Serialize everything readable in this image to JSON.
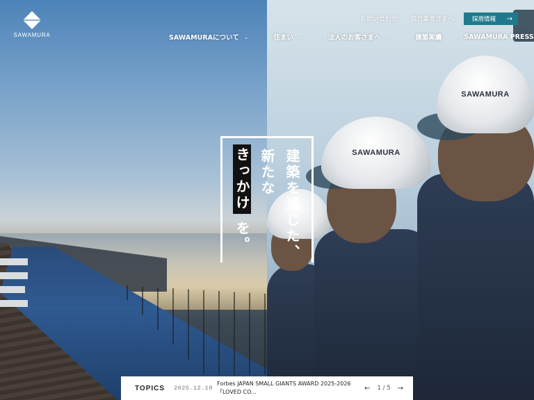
{
  "brand": {
    "name": "SAWAMURA"
  },
  "utility_links": [
    "お問い合わせ",
    "協力業者さまへ"
  ],
  "recruit": {
    "label": "採用情報",
    "arrow": "→"
  },
  "nav": [
    {
      "label": "SAWAMURAについて",
      "chevron": "⌄"
    },
    {
      "label": "住まい",
      "chevron": "⌄"
    },
    {
      "label": "法人のお客さまへ",
      "chevron": "⌄"
    },
    {
      "label": "建築実績",
      "chevron": ""
    },
    {
      "label": "SAWAMURA PRESS",
      "chevron": ""
    }
  ],
  "catchphrase": {
    "col1": "建築を通じた、",
    "col2": "新たな",
    "col3": "きっかけ",
    "col3_suffix": "を。"
  },
  "helmet_label": "SAWAMURA",
  "topics": {
    "label": "TOPICS",
    "date": "2025.12.10",
    "title": "Forbes JAPAN SMALL GIANTS AWARD 2025-2026「LOVED CO...",
    "pager": "1 / 5",
    "prev": "←",
    "next": "→"
  },
  "colors": {
    "accent": "#1e7a8c",
    "dark": "#111111"
  }
}
